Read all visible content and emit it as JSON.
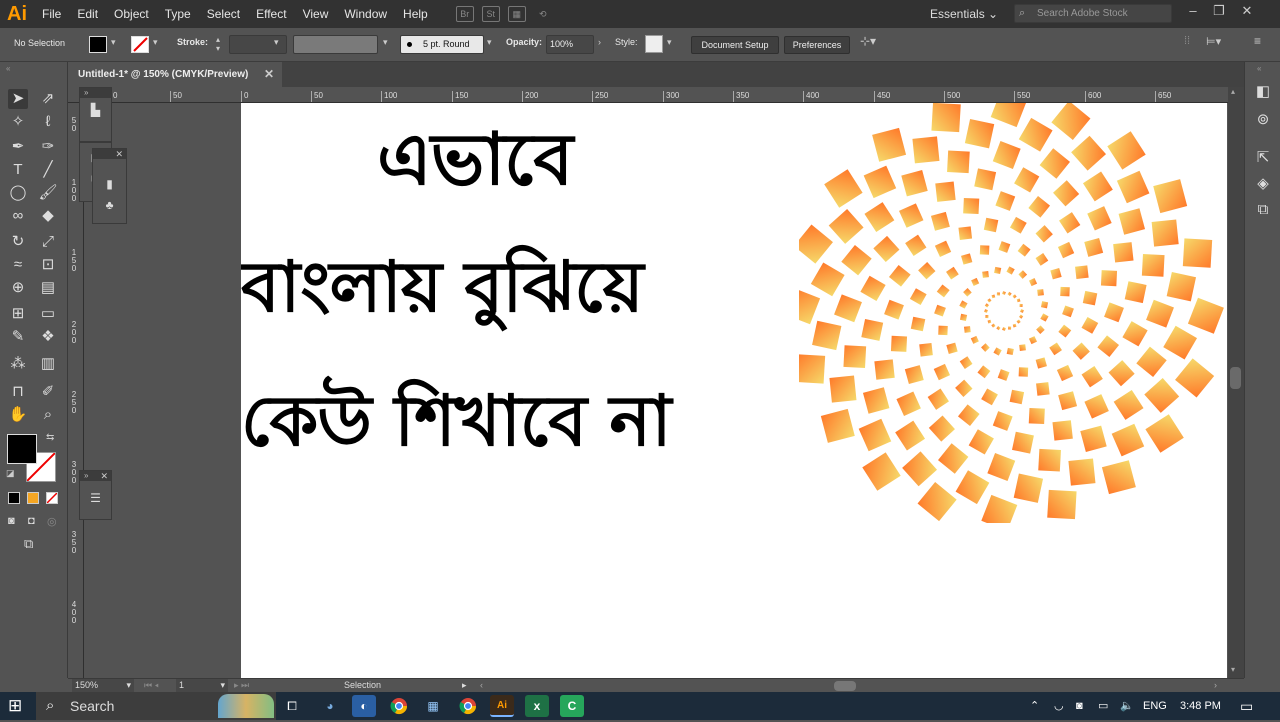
{
  "app": {
    "logo": "Ai",
    "menus": [
      "File",
      "Edit",
      "Object",
      "Type",
      "Select",
      "Effect",
      "View",
      "Window",
      "Help"
    ],
    "bridge": "Br",
    "stock": "St",
    "workspace": "Essentials",
    "search_placeholder": "Search Adobe Stock"
  },
  "control": {
    "selection": "No Selection",
    "stroke_label": "Stroke:",
    "brush": "5 pt. Round",
    "opacity_label": "Opacity:",
    "opacity": "100%",
    "style_label": "Style:",
    "doc_setup": "Document Setup",
    "preferences": "Preferences"
  },
  "document": {
    "tab": "Untitled-1* @ 150% (CMYK/Preview)"
  },
  "ruler": {
    "h": [
      "0",
      "50",
      "0",
      "50",
      "100",
      "150",
      "200",
      "250",
      "300",
      "350",
      "400",
      "450",
      "500",
      "550",
      "600",
      "650"
    ],
    "v": [
      "5 0",
      "1 0 0",
      "1 5 0",
      "2 0 0",
      "2 5 0",
      "3 0 0",
      "3 5 0",
      "4 0 0"
    ]
  },
  "artwork": {
    "line1": "এভাবে",
    "line2": "বাংলায় বুঝিয়ে",
    "line3": "কেউ শিখাবে না"
  },
  "status": {
    "zoom": "150%",
    "page": "1",
    "tool": "Selection"
  },
  "taskbar": {
    "search": "Search",
    "lang": "ENG",
    "time": "3:48 PM"
  },
  "colors": {
    "menubar": "#323232",
    "ui": "#535353",
    "accent": "#FF9A00",
    "spiral_inner": "#F6D96A",
    "spiral_outer": "#FF7A2A"
  }
}
